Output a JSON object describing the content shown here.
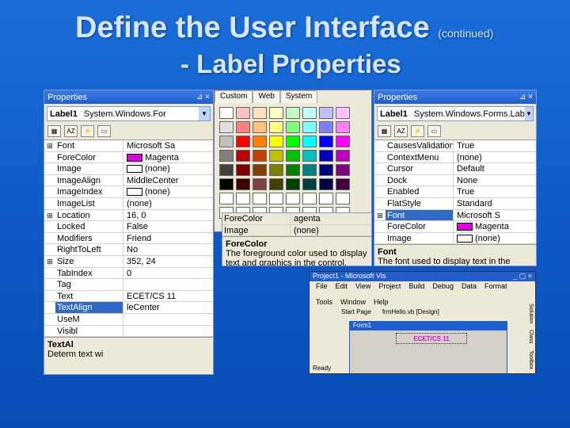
{
  "slide": {
    "title": "Define the User Interface",
    "continued": "(continued)",
    "subtitle": "- Label Properties"
  },
  "left_win": {
    "title": "Properties",
    "pin": "⊿ ×",
    "object": "Label1",
    "type": "System.Windows.For",
    "rows": [
      {
        "ex": "⊞",
        "n": "Font",
        "v": "Microsoft Sa"
      },
      {
        "ex": "",
        "n": "ForeColor",
        "v": "Magenta",
        "c": "#e000e0"
      },
      {
        "ex": "",
        "n": "Image",
        "v": "(none)",
        "c": "#ffffff"
      },
      {
        "ex": "",
        "n": "ImageAlign",
        "v": "MiddleCenter"
      },
      {
        "ex": "",
        "n": "ImageIndex",
        "v": "(none)",
        "c": "#ffffff"
      },
      {
        "ex": "",
        "n": "ImageList",
        "v": "(none)"
      },
      {
        "ex": "⊞",
        "n": "Location",
        "v": "16, 0"
      },
      {
        "ex": "",
        "n": "Locked",
        "v": "False"
      },
      {
        "ex": "",
        "n": "Modifiers",
        "v": "Friend"
      },
      {
        "ex": "",
        "n": "RightToLeft",
        "v": "No"
      },
      {
        "ex": "⊞",
        "n": "Size",
        "v": "352, 24"
      },
      {
        "ex": "",
        "n": "TabIndex",
        "v": "0"
      },
      {
        "ex": "",
        "n": "Tag",
        "v": ""
      },
      {
        "ex": "",
        "n": "Text",
        "v": "ECET/CS 11"
      },
      {
        "ex": "",
        "n": "TextAlign",
        "v": "leCenter",
        "sel": true
      },
      {
        "ex": "",
        "n": "UseM",
        "v": ""
      },
      {
        "ex": "",
        "n": "Visibl",
        "v": ""
      }
    ],
    "desc_title": "TextAl",
    "desc_text": "Determ text wi"
  },
  "palette": {
    "tabs": [
      "Custom",
      "Web",
      "System"
    ],
    "colors": [
      "#ffffff",
      "#ffc0c0",
      "#ffe0c0",
      "#ffffc0",
      "#c0ffc0",
      "#c0ffff",
      "#c0c0ff",
      "#ffc0ff",
      "#e0e0e0",
      "#ff8080",
      "#ffc080",
      "#ffff80",
      "#80ff80",
      "#80ffff",
      "#8080ff",
      "#ff80ff",
      "#c0c0c0",
      "#ff0000",
      "#ff8000",
      "#ffff00",
      "#00ff00",
      "#00ffff",
      "#0000ff",
      "#ff00ff",
      "#808080",
      "#c00000",
      "#c04000",
      "#c0c000",
      "#00c000",
      "#00c0c0",
      "#0000c0",
      "#c000c0",
      "#404040",
      "#800000",
      "#804000",
      "#808000",
      "#008000",
      "#008080",
      "#000080",
      "#800080",
      "#000000",
      "#400000",
      "#804040",
      "#404000",
      "#004000",
      "#004040",
      "#000040",
      "#400040",
      "#ffffff",
      "#ffffff",
      "#ffffff",
      "#ffffff",
      "#ffffff",
      "#ffffff",
      "#ffffff",
      "#ffffff",
      "#ffffff",
      "#ffffff",
      "#ffffff",
      "#ffffff",
      "#ffffff",
      "#ffffff",
      "#ffffff",
      "#ffffff"
    ],
    "below_rows": [
      {
        "n": "ForeColor",
        "v": "agenta"
      },
      {
        "n": "Image",
        "v": "(none)"
      }
    ],
    "desc_title": "ForeColor",
    "desc_text": "The foreground color used to display text and graphics in the control."
  },
  "right_win": {
    "title": "Properties",
    "pin": "⊿ ×",
    "object": "Label1",
    "type": "System.Windows.Forms.Lab",
    "rows": [
      {
        "ex": "",
        "n": "CausesValidation",
        "v": "True"
      },
      {
        "ex": "",
        "n": "ContextMenu",
        "v": "(none)"
      },
      {
        "ex": "",
        "n": "Cursor",
        "v": "Default"
      },
      {
        "ex": "",
        "n": "Dock",
        "v": "None"
      },
      {
        "ex": "",
        "n": "Enabled",
        "v": "True"
      },
      {
        "ex": "",
        "n": "FlatStyle",
        "v": "Standard"
      },
      {
        "ex": "⊞",
        "n": "Font",
        "v": "Microsoft S",
        "sel": true
      },
      {
        "ex": "",
        "n": "ForeColor",
        "v": "Magenta",
        "c": "#e000e0"
      },
      {
        "ex": "",
        "n": "Image",
        "v": "(none)",
        "c": "#ffffff"
      }
    ],
    "desc_title": "Font",
    "desc_text": "The font used to display text in the control."
  },
  "vs": {
    "title": "Project1 - Microsoft Vis",
    "menu": [
      "File",
      "Edit",
      "View",
      "Project",
      "Build",
      "Debug",
      "Data",
      "Format",
      "Tools",
      "Window",
      "Help"
    ],
    "tab": "Start Page",
    "file": "frmHello.vb [Design]",
    "form_title": "Form1",
    "label": "ECET/CS 11",
    "status": "Ready",
    "side": [
      "Solution",
      "Class",
      "Toolbox"
    ]
  }
}
